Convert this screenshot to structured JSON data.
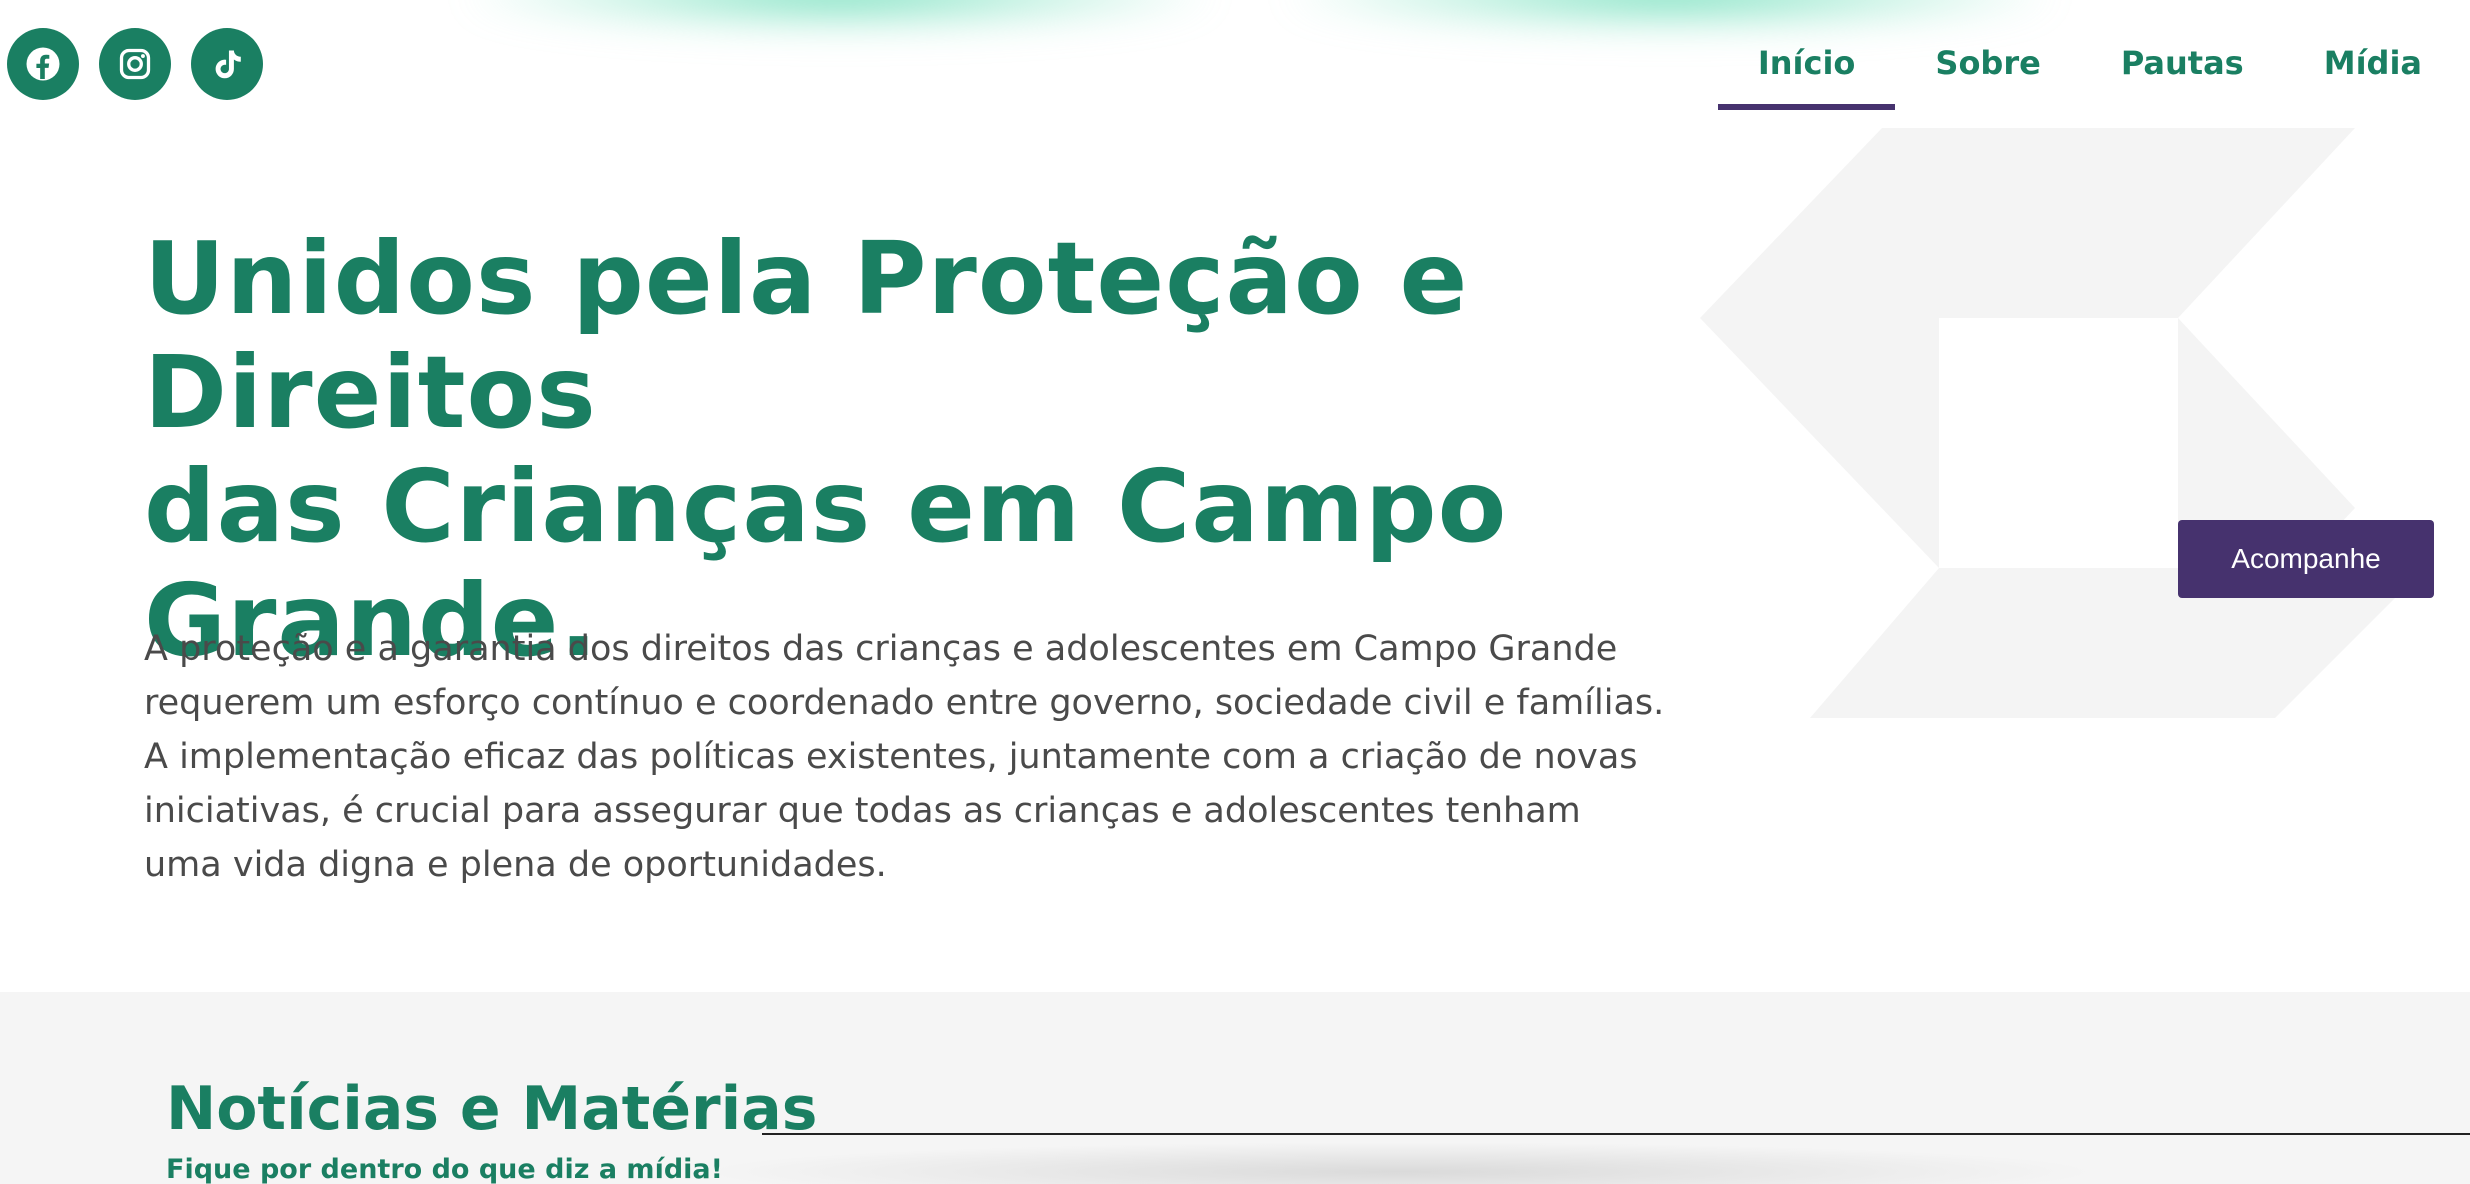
{
  "social": {
    "facebook_icon": "facebook-icon",
    "instagram_icon": "instagram-icon",
    "tiktok_icon": "tiktok-icon"
  },
  "nav": {
    "items": [
      {
        "label": "Início",
        "active": true
      },
      {
        "label": "Sobre",
        "active": false
      },
      {
        "label": "Pautas",
        "active": false
      },
      {
        "label": "Mídia",
        "active": false
      }
    ]
  },
  "hero": {
    "title_line1": "Unidos pela Proteção e Direitos",
    "title_line2": "das Crianças em Campo",
    "title_line3": "Grande.",
    "paragraph_line1": "A proteção e a garantia dos direitos das crianças e adolescentes em Campo Grande",
    "paragraph_line2": "requerem um esforço contínuo e coordenado entre governo, sociedade civil e famílias.",
    "paragraph_line3": "A implementação eficaz das políticas existentes, juntamente com a criação de novas",
    "paragraph_line4": "iniciativas, é crucial para assegurar que todas as crianças e adolescentes tenham",
    "paragraph_line5": "uma vida digna e plena de oportunidades.",
    "cta_label": "Acompanhe"
  },
  "news": {
    "title": "Notícias e Matérias",
    "subtitle": "Fique por dentro do que diz a mídia!"
  },
  "colors": {
    "brand_green": "#1a7f62",
    "accent_purple": "#46326e",
    "text_gray": "#4a4a4a",
    "section_bg": "#f5f5f5"
  }
}
